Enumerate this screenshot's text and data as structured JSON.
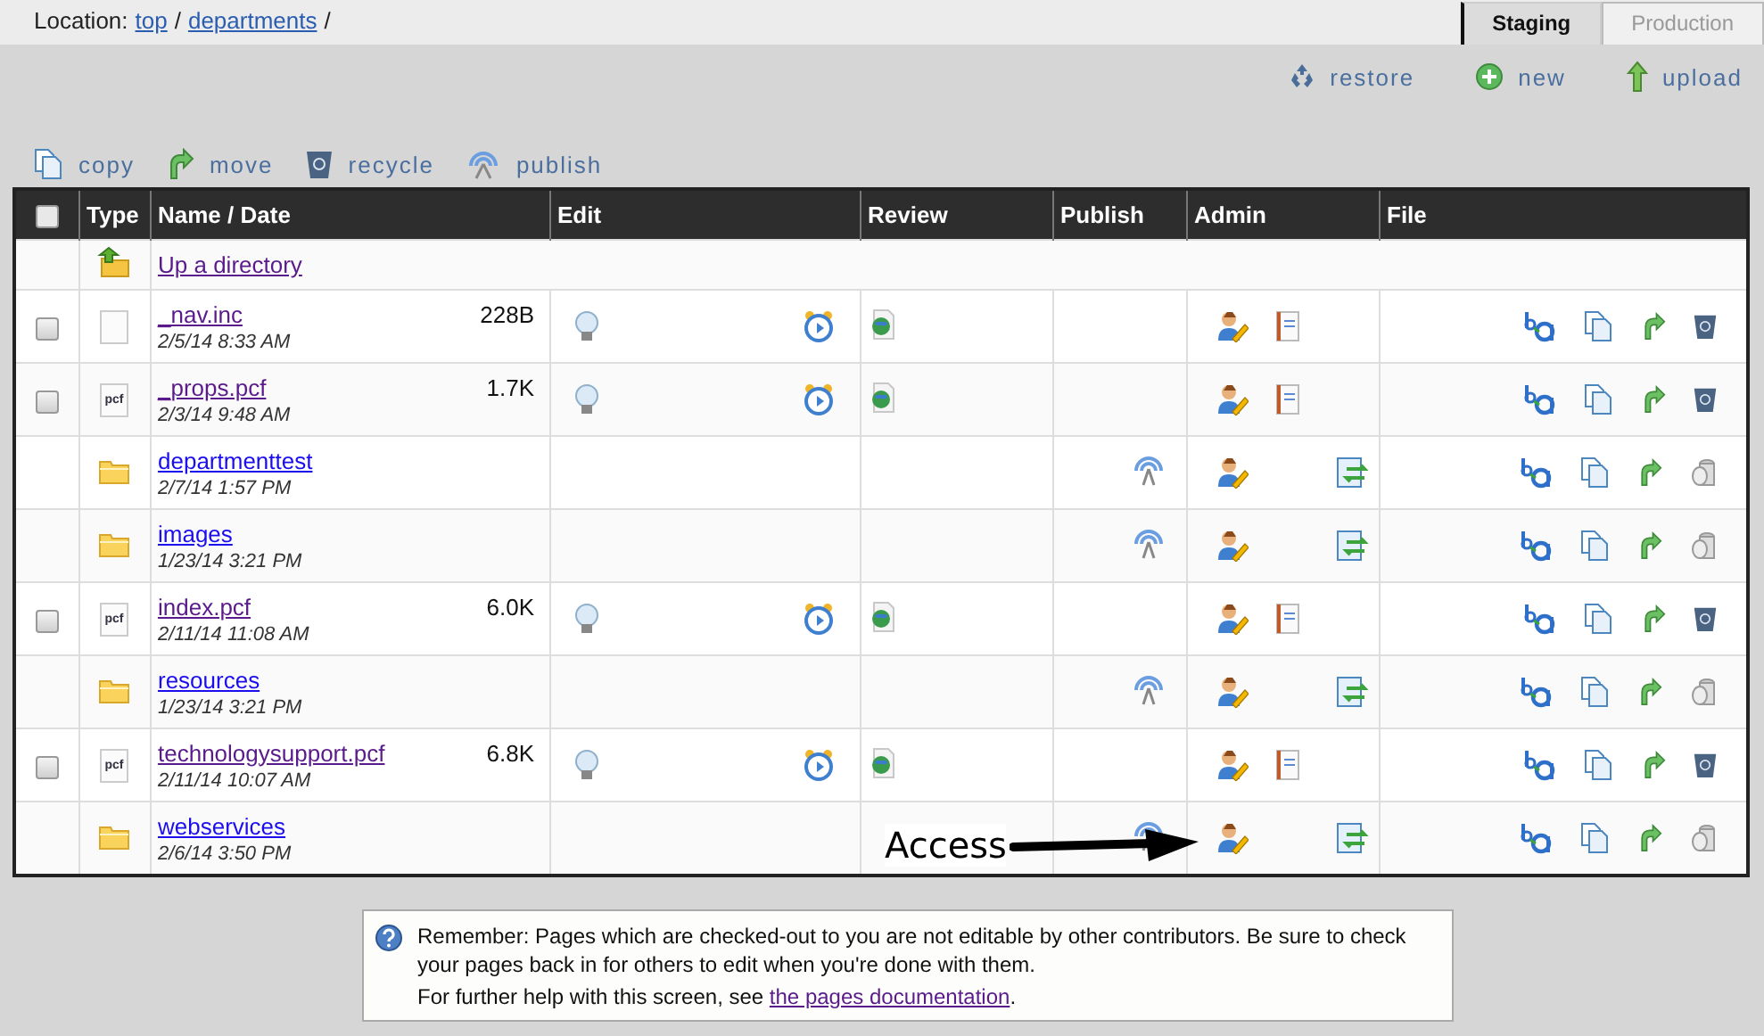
{
  "location": {
    "label": "Location:",
    "crumbs": [
      {
        "text": "top",
        "sep": "/"
      },
      {
        "text": "departments",
        "sep": "/"
      }
    ]
  },
  "tabs": [
    {
      "label": "Staging",
      "selected": true
    },
    {
      "label": "Production",
      "selected": false
    }
  ],
  "top_actions": [
    {
      "label": "restore",
      "kind": "restore"
    },
    {
      "label": "new",
      "kind": "new"
    },
    {
      "label": "upload",
      "kind": "upload"
    }
  ],
  "toolbar": [
    {
      "label": "copy",
      "kind": "copy"
    },
    {
      "label": "move",
      "kind": "move"
    },
    {
      "label": "recycle",
      "kind": "recycle"
    },
    {
      "label": "publish",
      "kind": "publish"
    }
  ],
  "table": {
    "header_checked": false,
    "columns": [
      "Type",
      "Name / Date",
      "Edit",
      "Review",
      "Publish",
      "Admin",
      "File"
    ],
    "up_row": {
      "label": "Up a directory",
      "visited": true
    },
    "rows": [
      {
        "kind": "file",
        "type_label": "",
        "name": "_nav.inc",
        "date": "2/5/14 8:33 AM",
        "size": "228B",
        "visited": true,
        "checked": false
      },
      {
        "kind": "file",
        "type_label": "pcf",
        "name": "_props.pcf",
        "date": "2/3/14 9:48 AM",
        "size": "1.7K",
        "visited": true,
        "checked": false
      },
      {
        "kind": "folder",
        "name": "departmenttest",
        "date": "2/7/14 1:57 PM",
        "visited": false
      },
      {
        "kind": "folder",
        "name": "images",
        "date": "1/23/14 3:21 PM",
        "visited": false
      },
      {
        "kind": "file",
        "type_label": "pcf",
        "name": "index.pcf",
        "date": "2/11/14 11:08 AM",
        "size": "6.0K",
        "visited": true,
        "checked": false
      },
      {
        "kind": "folder",
        "name": "resources",
        "date": "1/23/14 3:21 PM",
        "visited": false
      },
      {
        "kind": "file",
        "type_label": "pcf",
        "name": "technologysupport.pcf",
        "date": "2/11/14 10:07 AM",
        "size": "6.8K",
        "visited": true,
        "checked": false
      },
      {
        "kind": "folder",
        "name": "webservices",
        "date": "2/6/14 3:50 PM",
        "visited": false
      }
    ]
  },
  "annotation": {
    "text": "Access"
  },
  "note": {
    "text": "Remember: Pages which are checked-out to you are not editable by other contributors. Be sure to check your pages back in for others to edit when you're done with them.",
    "help_prefix": "For further help with this screen, see ",
    "link": "the pages documentation",
    "suffix": "."
  }
}
